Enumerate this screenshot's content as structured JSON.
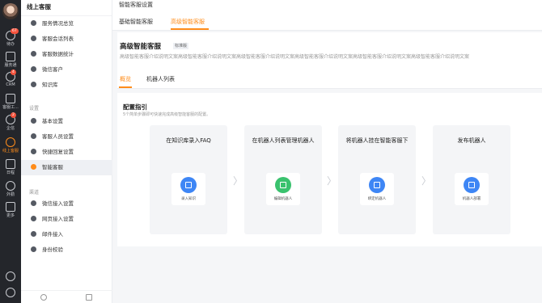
{
  "rail": {
    "items": [
      {
        "label": "待办",
        "badge": "67",
        "icon": "check-icon"
      },
      {
        "label": "服务通",
        "badge": "",
        "icon": "doc-icon"
      },
      {
        "label": "CRM",
        "badge": "4",
        "icon": "clock-icon"
      },
      {
        "label": "客服工...",
        "badge": "",
        "icon": "box-icon"
      },
      {
        "label": "企信",
        "badge": "2",
        "icon": "chat-icon"
      },
      {
        "label": "线上客服",
        "badge": "",
        "icon": "smile-icon"
      },
      {
        "label": "日程",
        "badge": "",
        "icon": "calendar-icon"
      },
      {
        "label": "外勤",
        "badge": "",
        "icon": "location-icon"
      },
      {
        "label": "更多",
        "badge": "",
        "icon": "grid-icon"
      }
    ]
  },
  "menu": {
    "title": "线上客服",
    "items1": [
      "服务情况总览",
      "客服会话列表",
      "客服数据统计",
      "微信客户",
      "知识库"
    ],
    "section2": "设置",
    "items2": [
      "基本设置",
      "客服人员设置",
      "快捷回复设置",
      "智能客服"
    ],
    "section3": "渠道",
    "items3": [
      "微信接入设置",
      "网页接入设置",
      "邮件接入",
      "身份校验"
    ]
  },
  "topbar": {
    "title": "智能客服设置"
  },
  "tabs": [
    "基础智能客服",
    "高级智能客服"
  ],
  "card": {
    "title": "高级智能客服",
    "tag": "标准版",
    "desc": "高级智能客服介绍说明文案高级智能客服介绍说明文案高级智能客服介绍说明文案高级智能客服介绍说明文案高级智能客服介绍说明文案高级智能客服介绍说明文案"
  },
  "subtabs": [
    "概览",
    "机器人列表"
  ],
  "guide": {
    "title": "配置指引",
    "sub": "5个简单步骤即可快速完成高级智能客服的配置。",
    "steps": [
      {
        "title": "在知识库录入FAQ",
        "button": "录入知识"
      },
      {
        "title": "在机器人列表管理机器人",
        "button": "编辑机器人"
      },
      {
        "title": "将机器人挂在智能客服下",
        "button": "绑定机器人"
      },
      {
        "title": "发布机器人",
        "button": "机器人部署"
      }
    ]
  },
  "colors": {
    "accent": "#ff8c1a",
    "blue": "#3e86f5",
    "green": "#3ac26e"
  }
}
